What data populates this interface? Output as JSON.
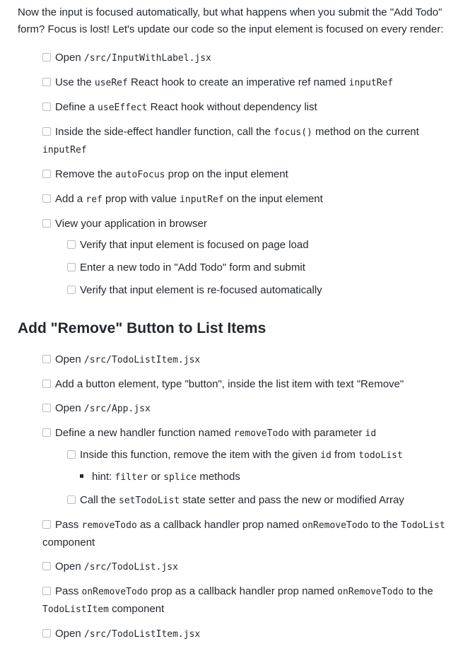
{
  "intro": "Now the input is focused automatically, but what happens when you submit the \"Add Todo\" form? Focus is lost! Let's update our code so the input element is focused on every render:",
  "list1": {
    "i1": {
      "a": "Open ",
      "c": "/src/InputWithLabel.jsx"
    },
    "i2": {
      "a": "Use the ",
      "c": "useRef",
      "b": " React hook to create an imperative ref named ",
      "c2": "inputRef"
    },
    "i3": {
      "a": "Define a ",
      "c": "useEffect",
      "b": " React hook without dependency list"
    },
    "i4": {
      "a": "Inside the side-effect handler function, call the ",
      "c": "focus()",
      "b": " method on the current ",
      "c2": "inputRef"
    },
    "i5": {
      "a": "Remove the ",
      "c": "autoFocus",
      "b": " prop on the input element"
    },
    "i6": {
      "a": "Add a ",
      "c": "ref",
      "b": " prop with value ",
      "c2": "inputRef",
      "d": " on the input element"
    },
    "i7": {
      "a": "View your application in browser"
    },
    "sub": [
      "Verify that input element is focused on page load",
      "Enter a new todo in \"Add Todo\" form and submit",
      "Verify that input element is re-focused automatically"
    ]
  },
  "heading": "Add \"Remove\" Button to List Items",
  "list2": {
    "i1": {
      "a": "Open ",
      "c": "/src/TodoListItem.jsx"
    },
    "i2": {
      "a": "Add a button element, type \"button\", inside the list item with text \"Remove\""
    },
    "i3": {
      "a": "Open ",
      "c": "/src/App.jsx"
    },
    "i4": {
      "a": "Define a new handler function named ",
      "c": "removeTodo",
      "b": " with parameter ",
      "c2": "id"
    },
    "s1": {
      "a": "Inside this function, remove the item with the given ",
      "c": "id",
      "b": " from ",
      "c2": "todoList"
    },
    "hint": {
      "a": "hint: ",
      "c": "filter",
      "b": " or ",
      "c2": "splice",
      "d": " methods"
    },
    "s2": {
      "a": "Call the ",
      "c": "setTodoList",
      "b": " state setter and pass the new or modified Array"
    },
    "i5": {
      "a": "Pass ",
      "c": "removeTodo",
      "b": " as a callback handler prop named ",
      "c2": "onRemoveTodo",
      "d": " to the ",
      "c3": "TodoList",
      "e": " component"
    },
    "i6": {
      "a": "Open ",
      "c": "/src/TodoList.jsx"
    },
    "i7": {
      "a": "Pass ",
      "c": "onRemoveTodo",
      "b": " prop as a callback handler prop named ",
      "c2": "onRemoveTodo",
      "d": " to the ",
      "c3": "TodoListItem",
      "e": " component"
    },
    "i8": {
      "a": "Open ",
      "c": "/src/TodoListItem.jsx"
    }
  }
}
